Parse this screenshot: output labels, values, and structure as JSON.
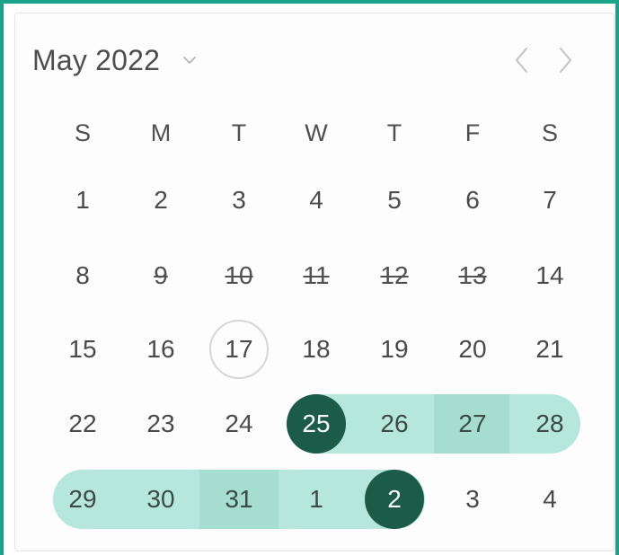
{
  "calendar": {
    "month_label": "May 2022",
    "toggle_icon": "chevron-down-icon",
    "prev_icon": "chevron-left-icon",
    "next_icon": "chevron-right-icon",
    "weekdays": [
      "S",
      "M",
      "T",
      "W",
      "T",
      "F",
      "S"
    ],
    "weeks": [
      [
        "1",
        "2",
        "3",
        "4",
        "5",
        "6",
        "7"
      ],
      [
        "8",
        "9",
        "10",
        "11",
        "12",
        "13",
        "14"
      ],
      [
        "15",
        "16",
        "17",
        "18",
        "19",
        "20",
        "21"
      ],
      [
        "22",
        "23",
        "24",
        "25",
        "26",
        "27",
        "28"
      ],
      [
        "29",
        "30",
        "31",
        "1",
        "2",
        "3",
        "4"
      ]
    ],
    "disabled_dates": [
      "9",
      "10",
      "11",
      "12",
      "13"
    ],
    "today": "17",
    "range_start": "May 25",
    "range_end": "June 2",
    "colors": {
      "accent_border": "#1aa388",
      "range_fill": "#b6e7dc",
      "range_fill_alt": "#a5ddd0",
      "endpoint": "#1b5b47"
    }
  }
}
